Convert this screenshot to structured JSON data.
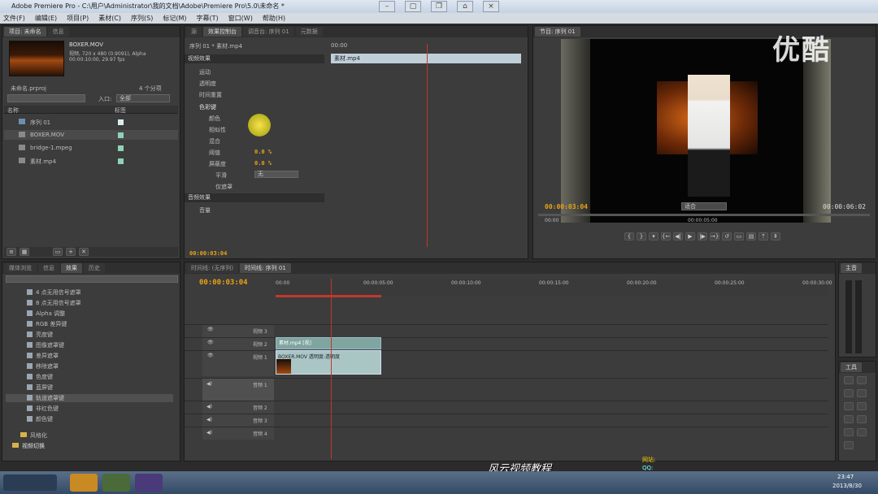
{
  "window": {
    "title": "Adobe Premiere Pro - C:\\用户\\Administrator\\我的文档\\Adobe\\Premiere Pro\\5.0\\未命名 *"
  },
  "menu": [
    "文件(F)",
    "编辑(E)",
    "项目(P)",
    "素材(C)",
    "序列(S)",
    "标记(M)",
    "字幕(T)",
    "窗口(W)",
    "帮助(H)"
  ],
  "project": {
    "tabs": [
      "项目: 未命名",
      "信息",
      "效果控制台"
    ],
    "clip_name": "BOXER.MOV",
    "clip_info": "视频, 720 x 480 (0.9091), Alpha",
    "clip_info2": "00:00:10:00, 29.97 fps",
    "project_name": "未命名.prproj",
    "item_count": "4 个分项",
    "inout_label": "入口:",
    "inout_value": "全部",
    "col_name": "名称",
    "col_label": "标签",
    "items": [
      "序列 01",
      "BOXER.MOV",
      "bridge-1.mpeg",
      "素材.mp4"
    ]
  },
  "effect_controls": {
    "tabs": [
      "源",
      "效果控制台",
      "调音台: 序列 01",
      "元数据"
    ],
    "seq_label": "序列 01 * 素材.mp4",
    "clip_label": "素材.mp4",
    "ruler_time": "00:00",
    "video_effects": "视频效果",
    "motion": "运动",
    "opacity": "透明度",
    "time_remap": "时间重置",
    "color_key": "色彩键",
    "color": "颜色",
    "similarity": "相似性",
    "blend": "混合",
    "threshold": "阈值",
    "threshold_value": "0.0 %",
    "cutoff": "屏蔽度",
    "cutoff_value": "0.0 %",
    "smoothing": "平滑",
    "smoothing_value": "无",
    "mask_only": "仅遮罩",
    "audio_effects": "音频效果",
    "volume": "音量",
    "bottom_time": "00:00:03:04"
  },
  "program": {
    "tab": "节目: 序列 01",
    "time_left": "00:00:03:04",
    "time_right": "00:00:06:02",
    "fit": "适合",
    "ruler_left": "00:00",
    "ruler_mid": "00:00:05:00"
  },
  "effects": {
    "tabs": [
      "媒体浏览",
      "信息",
      "效果",
      "历史"
    ],
    "items": [
      "4 点无用信号遮罩",
      "8 点无用信号遮罩",
      "Alpha 调整",
      "RGB 差异键",
      "亮度键",
      "图像遮罩键",
      "差异遮罩",
      "移除遮罩",
      "色度键",
      "蓝屏键",
      "轨道遮罩键",
      "非红色键",
      "颜色键"
    ],
    "folder1": "风格化",
    "folder2": "视频切换"
  },
  "timeline": {
    "tabs": [
      "时间线: (无序列)",
      "时间线: 序列 01"
    ],
    "time": "00:00:03:04",
    "ruler": [
      "00:00",
      "00:00:05:00",
      "00:00:10:00",
      "00:00:15:00",
      "00:00:20:00",
      "00:00:25:00",
      "00:00:30:00"
    ],
    "video_tracks": [
      "视频 3",
      "视频 2",
      "视频 1"
    ],
    "audio_tracks": [
      "音频 1",
      "音频 2",
      "音频 3",
      "音频 4"
    ],
    "clip_v2": "素材.mp4 [视]",
    "clip_v1": "BOXER.MOV 透明度:透明度"
  },
  "audio_master": {
    "tab": "主音"
  },
  "tools": {
    "tab": "工具"
  },
  "watermark": {
    "brand": "优酷",
    "overlay": "风云视频教程",
    "contact1": "网站:",
    "contact2": "QQ:"
  },
  "taskbar": {
    "clock": "23:47",
    "date": "2013/8/30"
  }
}
